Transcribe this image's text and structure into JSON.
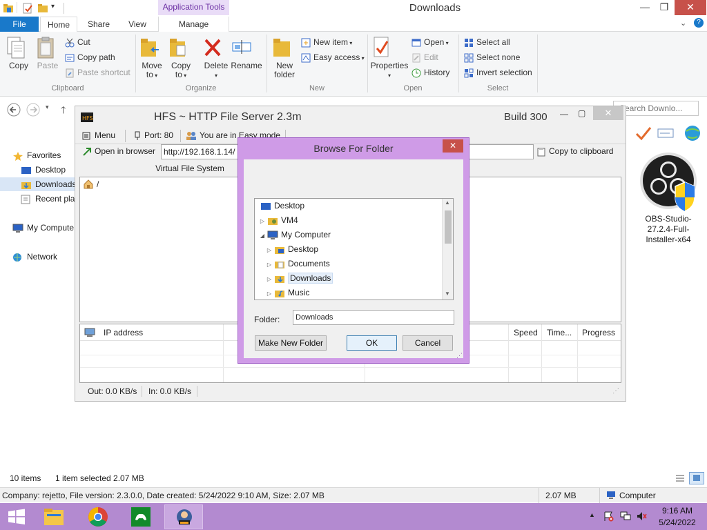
{
  "explorer": {
    "title": "Downloads",
    "context_tab": "Application Tools",
    "tabs": [
      "File",
      "Home",
      "Share",
      "View",
      "Manage"
    ],
    "ribbon": {
      "clipboard": {
        "label": "Clipboard",
        "copy": "Copy",
        "paste": "Paste",
        "cut": "Cut",
        "copy_path": "Copy path",
        "paste_shortcut": "Paste shortcut"
      },
      "organize": {
        "label": "Organize",
        "move_to_1": "Move",
        "move_to_2": "to",
        "copy_to_1": "Copy",
        "copy_to_2": "to",
        "delete": "Delete",
        "rename": "Rename"
      },
      "new": {
        "label": "New",
        "new_folder_1": "New",
        "new_folder_2": "folder",
        "new_item": "New item",
        "easy_access": "Easy access"
      },
      "open": {
        "label": "Open",
        "properties": "Properties",
        "open": "Open",
        "edit": "Edit",
        "history": "History"
      },
      "select": {
        "label": "Select",
        "select_all": "Select all",
        "select_none": "Select none",
        "invert": "Invert selection"
      }
    },
    "search_placeholder": "Search Downlo...",
    "nav": {
      "favorites": "Favorites",
      "desktop": "Desktop",
      "downloads": "Downloads",
      "recent": "Recent plac",
      "computer": "My Compute",
      "network": "Network"
    },
    "status": {
      "items": "10 items",
      "selected": "1 item selected  2.07 MB"
    },
    "details": {
      "info": "Company: rejetto, File version: 2.3.0.0, Date created: 5/24/2022 9:10 AM, Size: 2.07 MB",
      "size": "2.07 MB",
      "location": "Computer"
    }
  },
  "hfs": {
    "title": "HFS ~ HTTP File Server 2.3m",
    "build": "Build 300",
    "menu": "Menu",
    "port": "Port: 80",
    "mode": "You are in Easy mode",
    "open_in_browser": "Open in browser",
    "url": "http://192.168.1.14/",
    "copy_clipboard": "Copy to clipboard",
    "vfs_header": "Virtual File System",
    "vfs_root": "/",
    "columns": [
      "IP address",
      "Speed",
      "Time...",
      "Progress"
    ],
    "out": "Out: 0.0 KB/s",
    "in": "In: 0.0 KB/s"
  },
  "dialog": {
    "title": "Browse For Folder",
    "tree": [
      {
        "label": "Desktop",
        "level": 0,
        "arrow": "",
        "icon": "desktop-icon"
      },
      {
        "label": "VM4",
        "level": 0,
        "arrow": "▷",
        "icon": "user-folder-icon"
      },
      {
        "label": "My Computer",
        "level": 0,
        "arrow": "◢",
        "icon": "computer-icon"
      },
      {
        "label": "Desktop",
        "level": 1,
        "arrow": "▷",
        "icon": "desktop-folder-icon"
      },
      {
        "label": "Documents",
        "level": 1,
        "arrow": "▷",
        "icon": "documents-folder-icon"
      },
      {
        "label": "Downloads",
        "level": 1,
        "arrow": "▷",
        "icon": "downloads-folder-icon",
        "selected": true
      },
      {
        "label": "Music",
        "level": 1,
        "arrow": "▷",
        "icon": "music-folder-icon"
      }
    ],
    "folder_label": "Folder:",
    "folder_value": "Downloads",
    "make_new_folder": "Make New Folder",
    "ok": "OK",
    "cancel": "Cancel"
  },
  "desktop_icon": {
    "label": "OBS-Studio-27.2.4-Full-Installer-x64"
  },
  "taskbar": {
    "time": "9:16 AM",
    "date": "5/24/2022"
  },
  "colors": {
    "accent": "#1979ca",
    "dialog_frame": "#cf9be7",
    "taskbar": "#b38ad0",
    "close": "#c7514a"
  }
}
